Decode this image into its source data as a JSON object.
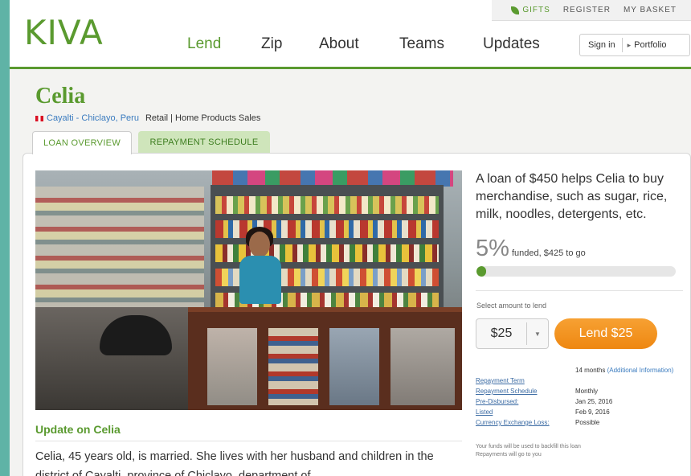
{
  "header": {
    "logo": "KIVA",
    "utility": {
      "gifts": "GIFTS",
      "register": "REGISTER",
      "basket": "MY BASKET"
    },
    "nav": [
      {
        "label": "Lend",
        "active": true
      },
      {
        "label": "Zip"
      },
      {
        "label": "About"
      },
      {
        "label": "Teams"
      },
      {
        "label": "Updates"
      }
    ],
    "auth": {
      "signin": "Sign in",
      "portfolio": "Portfolio"
    }
  },
  "borrower": {
    "name": "Celia",
    "location": "Cayalti - Chiclayo, Peru",
    "sector": "Retail | Home Products Sales"
  },
  "tabs": {
    "overview": "LOAN OVERVIEW",
    "schedule": "REPAYMENT SCHEDULE"
  },
  "loan": {
    "pitch": "A loan of $450 helps Celia to buy merchandise, such as sugar, rice, milk, noodles, detergents, etc.",
    "funded_pct": "5%",
    "funded_text": "funded, $425 to go",
    "funded_fraction": 0.05,
    "select_label": "Select amount to lend",
    "amount": "$25",
    "lend_button": "Lend $25"
  },
  "details": {
    "term_key": "Repayment Term",
    "term_val": "14 months",
    "term_extra": "(Additional Information)",
    "schedule_key": "Repayment Schedule",
    "schedule_val": "Monthly",
    "predisbursed_key": "Pre-Disbursed:",
    "predisbursed_val": "Jan 25, 2016",
    "listed_key": "Listed",
    "listed_val": "Feb 9, 2016",
    "fx_key": "Currency Exchange Loss:",
    "fx_val": "Possible",
    "note1": "Your funds will be used to backfill this loan",
    "note2": "Repayments will go to you"
  },
  "update": {
    "title": "Update on Celia",
    "description": "Celia, 45 years old, is married. She lives with her husband and children in the district of Cayalti, province of Chiclayo, department of"
  },
  "colors": {
    "brand": "#5a9a2f",
    "accent_orange": "#ee8711",
    "link": "#3a6aa3"
  }
}
